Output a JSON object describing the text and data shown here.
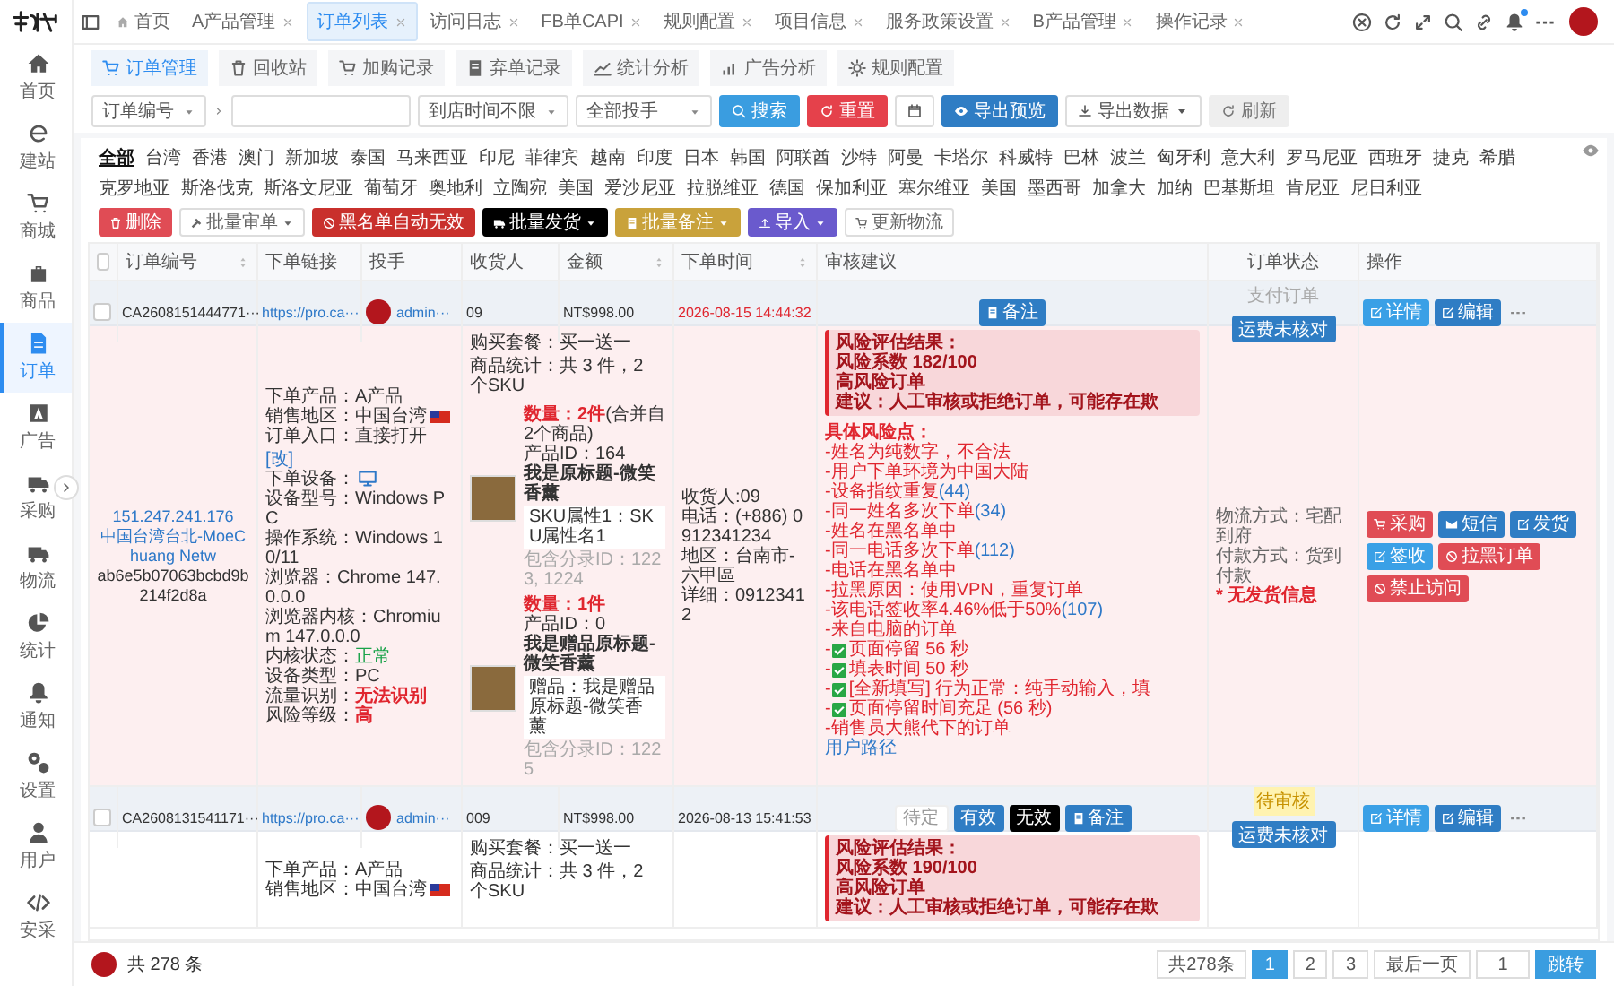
{
  "sidebar": {
    "items": [
      {
        "label": "首页",
        "selected": false
      },
      {
        "label": "建站",
        "selected": false
      },
      {
        "label": "商城",
        "selected": false
      },
      {
        "label": "商品",
        "selected": false
      },
      {
        "label": "订单",
        "selected": true
      },
      {
        "label": "广告",
        "selected": false
      },
      {
        "label": "采购",
        "selected": false
      },
      {
        "label": "物流",
        "selected": false
      },
      {
        "label": "统计",
        "selected": false
      },
      {
        "label": "通知",
        "selected": false
      },
      {
        "label": "设置",
        "selected": false
      },
      {
        "label": "用户",
        "selected": false
      },
      {
        "label": "安采",
        "selected": false
      }
    ]
  },
  "tabs": [
    {
      "label": "首页",
      "selected": false,
      "closable": false
    },
    {
      "label": "A产品管理",
      "selected": false,
      "closable": true
    },
    {
      "label": "订单列表",
      "selected": true,
      "closable": true
    },
    {
      "label": "访问日志",
      "selected": false,
      "closable": true
    },
    {
      "label": "FB单CAPI",
      "selected": false,
      "closable": true
    },
    {
      "label": "规则配置",
      "selected": false,
      "closable": true
    },
    {
      "label": "项目信息",
      "selected": false,
      "closable": true
    },
    {
      "label": "服务政策设置",
      "selected": false,
      "closable": true
    },
    {
      "label": "B产品管理",
      "selected": false,
      "closable": true
    },
    {
      "label": "操作记录",
      "selected": false,
      "closable": true
    }
  ],
  "subtabs": [
    {
      "label": "订单管理",
      "selected": true
    },
    {
      "label": "回收站",
      "selected": false
    },
    {
      "label": "加购记录",
      "selected": false
    },
    {
      "label": "弃单记录",
      "selected": false
    },
    {
      "label": "统计分析",
      "selected": false
    },
    {
      "label": "广告分析",
      "selected": false
    },
    {
      "label": "规则配置",
      "selected": false
    }
  ],
  "filters": {
    "field_select": "订单编号",
    "time_select": "到店时间不限",
    "pitcher_select": "全部投手",
    "buttons": [
      {
        "label": "搜索",
        "kind": "search"
      },
      {
        "label": "重置",
        "kind": "reset"
      }
    ],
    "export_buttons": [
      {
        "label": "导出预览",
        "kind": "preview"
      },
      {
        "label": "导出数据",
        "kind": "export"
      },
      {
        "label": "刷新",
        "kind": "refresh"
      }
    ]
  },
  "countries": [
    {
      "label": "全部",
      "selected": true
    },
    {
      "label": "台湾",
      "selected": false
    },
    {
      "label": "香港",
      "selected": false
    },
    {
      "label": "澳门",
      "selected": false
    },
    {
      "label": "新加坡",
      "selected": false
    },
    {
      "label": "泰国",
      "selected": false
    },
    {
      "label": "马来西亚",
      "selected": false
    },
    {
      "label": "印尼",
      "selected": false
    },
    {
      "label": "菲律宾",
      "selected": false
    },
    {
      "label": "越南",
      "selected": false
    },
    {
      "label": "印度",
      "selected": false
    },
    {
      "label": "日本",
      "selected": false
    },
    {
      "label": "韩国",
      "selected": false
    },
    {
      "label": "阿联酋",
      "selected": false
    },
    {
      "label": "沙特",
      "selected": false
    },
    {
      "label": "阿曼",
      "selected": false
    },
    {
      "label": "卡塔尔",
      "selected": false
    },
    {
      "label": "科威特",
      "selected": false
    },
    {
      "label": "巴林",
      "selected": false
    },
    {
      "label": "波兰",
      "selected": false
    },
    {
      "label": "匈牙利",
      "selected": false
    },
    {
      "label": "意大利",
      "selected": false
    },
    {
      "label": "罗马尼亚",
      "selected": false
    },
    {
      "label": "西班牙",
      "selected": false
    },
    {
      "label": "捷克",
      "selected": false
    },
    {
      "label": "希腊",
      "selected": false
    },
    {
      "label": "克罗地亚",
      "selected": false
    },
    {
      "label": "斯洛伐克",
      "selected": false
    },
    {
      "label": "斯洛文尼亚",
      "selected": false
    },
    {
      "label": "葡萄牙",
      "selected": false
    },
    {
      "label": "奥地利",
      "selected": false
    },
    {
      "label": "立陶宛",
      "selected": false
    },
    {
      "label": "美国",
      "selected": false
    },
    {
      "label": "爱沙尼亚",
      "selected": false
    },
    {
      "label": "拉脱维亚",
      "selected": false
    },
    {
      "label": "德国",
      "selected": false
    },
    {
      "label": "保加利亚",
      "selected": false
    },
    {
      "label": "塞尔维亚",
      "selected": false
    },
    {
      "label": "美国",
      "selected": false
    },
    {
      "label": "墨西哥",
      "selected": false
    },
    {
      "label": "加拿大",
      "selected": false
    },
    {
      "label": "加纳",
      "selected": false
    },
    {
      "label": "巴基斯坦",
      "selected": false
    },
    {
      "label": "肯尼亚",
      "selected": false
    },
    {
      "label": "尼日利亚",
      "selected": false
    }
  ],
  "bulk_actions": [
    {
      "label": "删除",
      "kind": "danger",
      "dropdown": false
    },
    {
      "label": "批量审单",
      "kind": "default",
      "dropdown": true
    },
    {
      "label": "黑名单自动无效",
      "kind": "blacklist",
      "dropdown": false
    },
    {
      "label": "批量发货",
      "kind": "dark",
      "dropdown": true
    },
    {
      "label": "批量备注",
      "kind": "gold",
      "dropdown": true
    },
    {
      "label": "导入",
      "kind": "purple",
      "dropdown": true
    },
    {
      "label": "更新物流",
      "kind": "default",
      "dropdown": false
    }
  ],
  "table": {
    "select_all": false,
    "columns": [
      {
        "label": "订单编号",
        "sortable": true
      },
      {
        "label": "下单链接",
        "sortable": false
      },
      {
        "label": "投手",
        "sortable": false
      },
      {
        "label": "收货人",
        "sortable": false
      },
      {
        "label": "金额",
        "sortable": true
      },
      {
        "label": "下单时间",
        "sortable": true
      },
      {
        "label": "审核建议",
        "sortable": false
      },
      {
        "label": "订单状态",
        "sortable": false
      },
      {
        "label": "操作",
        "sortable": false
      }
    ]
  },
  "orders": [
    {
      "selected": false,
      "order_no": "CA2608151444771···",
      "link": "https://pro.ca···",
      "pitcher": "admin···",
      "recipient": "09",
      "amount": "NT$998.00",
      "time": "2026-08-15 14:44:32",
      "time_highlighted": true,
      "review_buttons": [
        {
          "label": "备注",
          "kind": "note"
        }
      ],
      "status_tag": {
        "label": "支付订单",
        "kind": "plain"
      },
      "status_button": "运费未核对",
      "actions": [
        "详情",
        "编辑"
      ],
      "detail": {
        "highlighted": true,
        "ip": "151.247.241.176",
        "location": "中国台湾台北-MoeChuang Netw",
        "fingerprint": "ab6e5b07063bcbd9b214f2d8a",
        "device": [
          {
            "label": "下单产品：",
            "value": "A产品",
            "kind": "plain"
          },
          {
            "label": "销售地区：",
            "value": "中国台湾",
            "kind": "plain",
            "flag": true
          },
          {
            "label": "订单入口：",
            "value": "直接打开",
            "kind": "plain",
            "link": "[改]"
          },
          {
            "label": "下单设备：",
            "device_icon": true
          },
          {
            "label": "设备型号：",
            "value": "Windows PC",
            "kind": "plain"
          },
          {
            "label": "操作系统：",
            "value": "Windows 10/11",
            "kind": "plain"
          },
          {
            "label": "浏览器：",
            "value": "Chrome 147.0.0.0",
            "kind": "plain"
          },
          {
            "label": "浏览器内核：",
            "value": "Chromium 147.0.0.0",
            "kind": "plain"
          },
          {
            "label": "内核状态：",
            "value": "正常",
            "kind": "good"
          },
          {
            "label": "设备类型：",
            "value": "PC",
            "kind": "plain"
          },
          {
            "label": "流量识别：",
            "value": "无法识别",
            "kind": "bad"
          },
          {
            "label": "风险等级：",
            "value": "高",
            "kind": "bad"
          }
        ],
        "package": "购买套餐：买一送一",
        "stats": "商品统计：共 3 件，2 个SKU",
        "products": [
          {
            "qty": "数量：2件",
            "note": "(合并自2个商品)",
            "product_id": "产品ID：164",
            "name": "我是原标题-微笑香薰",
            "sku": "SKU属性1：SKU属性名1",
            "entries": "包含分录ID：1223, 1224"
          },
          {
            "qty": "数量：1件",
            "product_id": "产品ID：0",
            "name": "我是赠品原标题-微笑香薰",
            "sku": "赠品：我是赠品原标题-微笑香薰",
            "entries": "包含分录ID：1225"
          }
        ],
        "recipient_info": [
          "收货人:09",
          "电话：(+886) 0912341234",
          "地区：台南市-六甲區",
          "详细：09123412"
        ],
        "risk": {
          "summary": [
            "风险评估结果：",
            "风险系数 182/100",
            "高风险订单",
            "建议：人工审核或拒绝订单，可能存在欺"
          ],
          "heading": "具体风险点：",
          "points": [
            {
              "kind": "text",
              "text": "-姓名为纯数字，不合法"
            },
            {
              "kind": "text",
              "text": "-用户下单环境为中国大陆"
            },
            {
              "kind": "text",
              "text": "-设备指纹重复",
              "count": "(44)"
            },
            {
              "kind": "text",
              "text": "-同一姓名多次下单",
              "count": "(34)"
            },
            {
              "kind": "text",
              "text": "-姓名在黑名单中"
            },
            {
              "kind": "text",
              "text": "-同一电话多次下单",
              "count": "(112)"
            },
            {
              "kind": "text",
              "text": "-电话在黑名单中"
            },
            {
              "kind": "text",
              "text": "-拉黑原因：使用VPN，重复订单"
            },
            {
              "kind": "text",
              "text": "-该电话签收率4.46%低于50%",
              "count": "(107)"
            },
            {
              "kind": "text",
              "text": "-来自电脑的订单"
            },
            {
              "kind": "check",
              "prefix": "-",
              "text": "页面停留 56 秒"
            },
            {
              "kind": "check",
              "prefix": "-",
              "text": "填表时间 50 秒"
            },
            {
              "kind": "check",
              "prefix": "-",
              "text": "[全新填写] 行为正常：纯手动输入，填"
            },
            {
              "kind": "check",
              "prefix": "-",
              "text": "页面停留时间充足 (56 秒)"
            },
            {
              "kind": "text",
              "text": "-销售员大熊代下的订单"
            }
          ],
          "path_link": "用户路径"
        },
        "logistics": [
          {
            "text": "物流方式：宅配到府",
            "kind": "plain"
          },
          {
            "text": "付款方式：货到付款",
            "kind": "plain"
          },
          {
            "text": "* 无发货信息",
            "kind": "bad"
          }
        ],
        "action_buttons": [
          {
            "label": "采购",
            "kind": "red"
          },
          {
            "label": "短信",
            "kind": "blue"
          },
          {
            "label": "发货",
            "kind": "blue"
          },
          {
            "label": "签收",
            "kind": "light"
          },
          {
            "label": "拉黑订单",
            "kind": "red"
          },
          {
            "label": "禁止访问",
            "kind": "red"
          }
        ]
      }
    },
    {
      "selected": false,
      "order_no": "CA2608131541171···",
      "link": "https://pro.ca···",
      "pitcher": "admin···",
      "recipient": "009",
      "amount": "NT$998.00",
      "time": "2026-08-13 15:41:53",
      "time_highlighted": false,
      "review_buttons": [
        {
          "label": "待定",
          "kind": "plain"
        },
        {
          "label": "有效",
          "kind": "primary"
        },
        {
          "label": "无效",
          "kind": "dark"
        },
        {
          "label": "备注",
          "kind": "note"
        }
      ],
      "status_tag": {
        "label": "待审核",
        "kind": "pending"
      },
      "status_button": "运费未核对",
      "actions": [
        "详情",
        "编辑"
      ],
      "detail": {
        "highlighted": false,
        "device": [
          {
            "label": "下单产品：",
            "value": "A产品",
            "kind": "plain"
          },
          {
            "label": "销售地区：",
            "value": "中国台湾",
            "kind": "plain",
            "flag": true
          }
        ],
        "package": "购买套餐：买一送一",
        "stats": "商品统计：共 3 件，2 个SKU",
        "risk": {
          "summary": [
            "风险评估结果：",
            "风险系数 190/100",
            "高风险订单",
            "建议：人工审核或拒绝订单，可能存在欺"
          ]
        }
      }
    }
  ],
  "pagination": {
    "summary": "共 278 条",
    "total": "共278条",
    "pages": [
      {
        "label": "1",
        "selected": true
      },
      {
        "label": "2",
        "selected": false
      },
      {
        "label": "3",
        "selected": false
      }
    ],
    "last": "最后一页",
    "jump_value": "1",
    "jump": "跳转"
  }
}
